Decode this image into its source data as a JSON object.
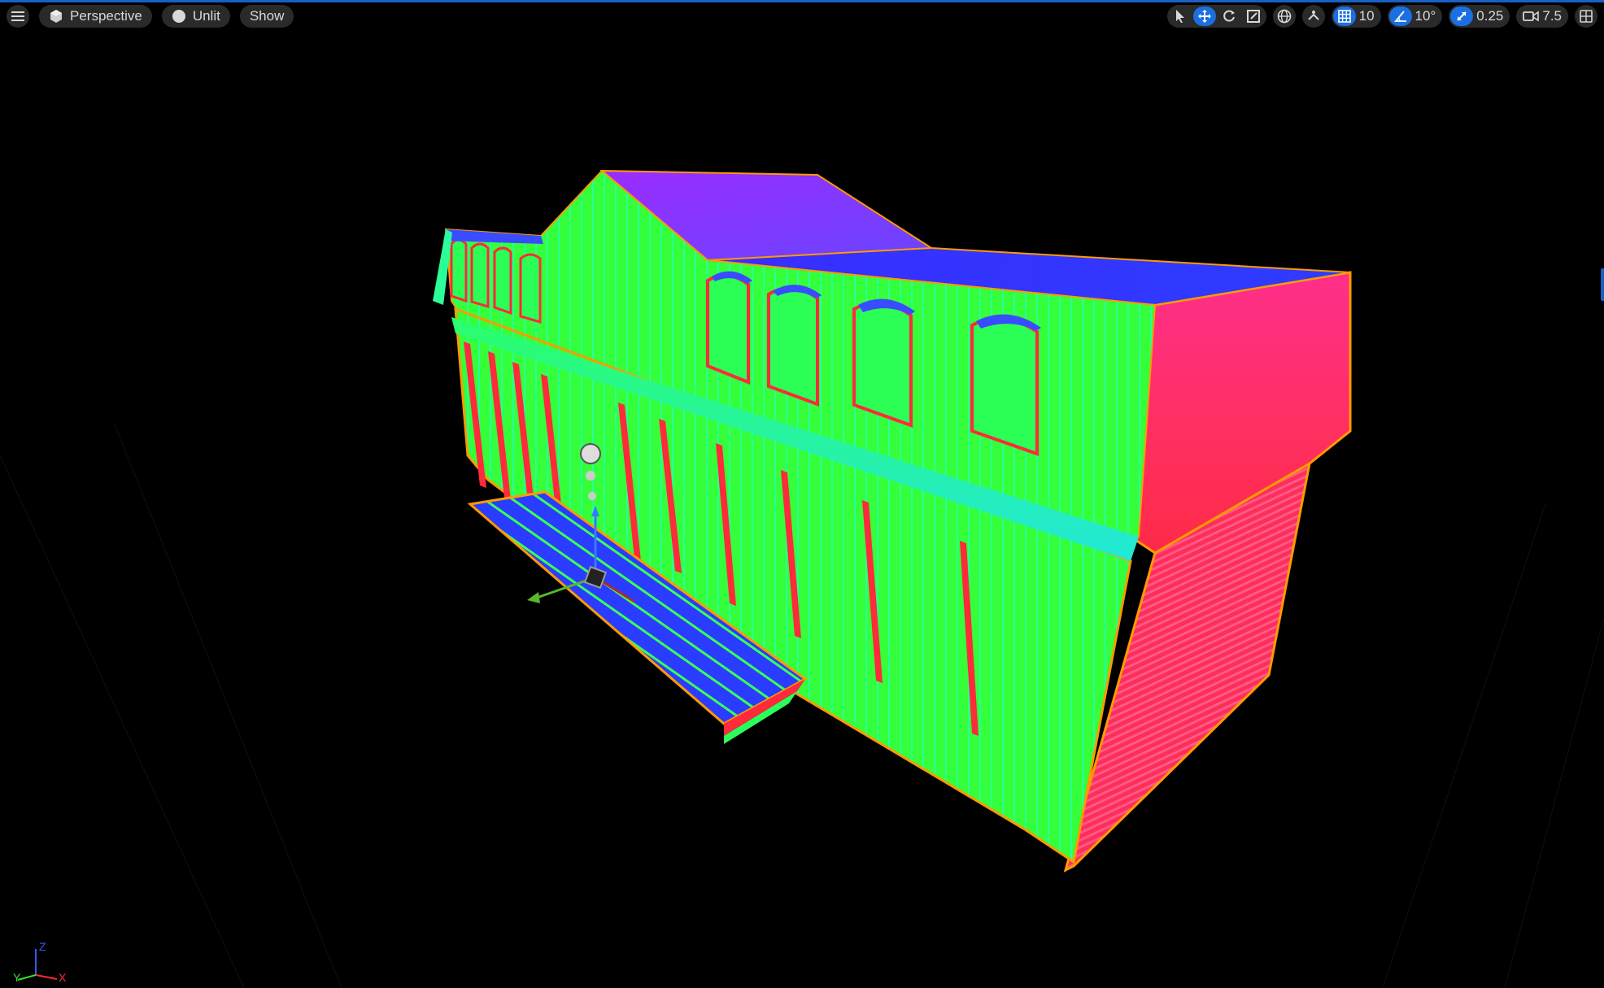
{
  "toolbar": {
    "view_mode": "Perspective",
    "lighting": "Unlit",
    "show": "Show",
    "grid_snap": "10",
    "rotation_snap": "10°",
    "scale_snap": "0.25",
    "camera_speed": "7.5"
  },
  "axis": {
    "z": "Z",
    "x": "X",
    "y": "Y"
  },
  "icons": {
    "menu": "hamburger-menu-icon",
    "view": "cube-icon",
    "lit": "sphere-icon",
    "select": "arrow-cursor-icon",
    "translate": "move-arrows-icon",
    "rotate": "rotate-icon",
    "scale": "scale-icon",
    "world": "globe-icon",
    "surface": "surface-snap-icon",
    "grid": "grid-icon",
    "angle": "angle-icon",
    "scale_snap": "scale-arrow-icon",
    "camera": "camera-icon",
    "layout": "layout-grid-icon"
  },
  "colors": {
    "accent": "#1b6fe0",
    "toolbar_bg": "#2a2a2a",
    "normal_green": "#2bff3c",
    "normal_red": "#ff2e5a",
    "normal_blue": "#2a3cff",
    "normal_purple": "#8a3cff",
    "selection_outline": "#ff9a00"
  }
}
